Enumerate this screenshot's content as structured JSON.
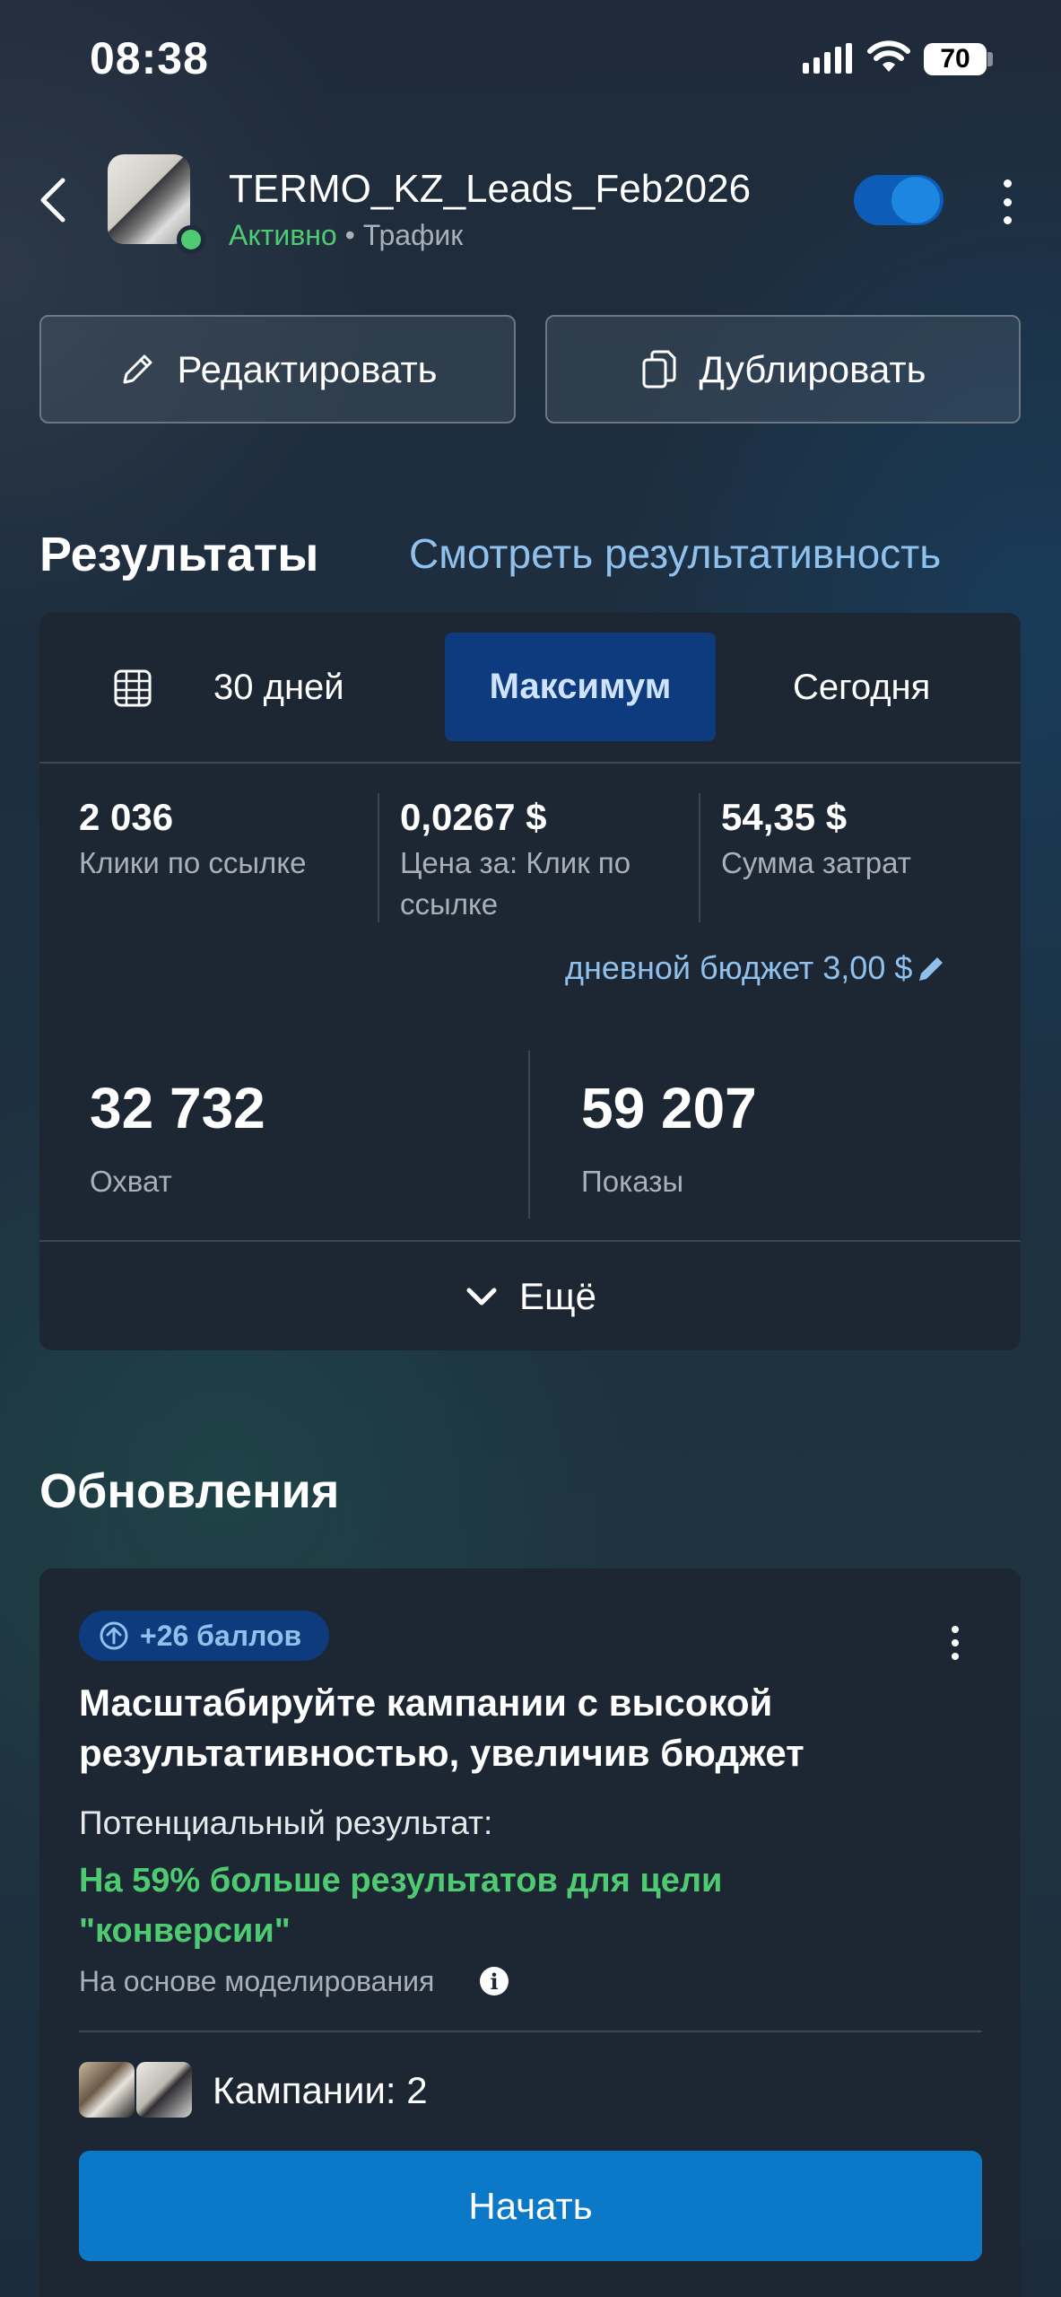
{
  "status_bar": {
    "time": "08:38",
    "battery": "70",
    "icons": [
      "signal-icon",
      "wifi-icon",
      "battery-icon"
    ]
  },
  "header": {
    "back_icon": "chevron-left-icon",
    "campaign_name": "TERMO_KZ_Leads_Feb2026",
    "status": "Активно",
    "separator": "•",
    "objective": "Трафик",
    "toggle_on": true,
    "more_icon": "kebab-icon"
  },
  "actions": {
    "edit_label": "Редактировать",
    "edit_icon": "pencil-icon",
    "duplicate_label": "Дублировать",
    "duplicate_icon": "copy-icon"
  },
  "results": {
    "title": "Результаты",
    "view_link": "Смотреть результативность",
    "tabs": [
      {
        "label": "30 дней",
        "icon": "calendar-icon",
        "active": false
      },
      {
        "label": "Максимум",
        "active": true
      },
      {
        "label": "Сегодня",
        "active": false
      }
    ],
    "metrics": [
      {
        "value": "2 036",
        "label": "Клики по ссылке"
      },
      {
        "value": "0,0267 $",
        "label": "Цена за: Клик по ссылке"
      },
      {
        "value": "54,35 $",
        "label": "Сумма затрат"
      }
    ],
    "daily_budget": "дневной бюджет 3,00 $",
    "big_metrics": [
      {
        "value": "32 732",
        "label": "Охват"
      },
      {
        "value": "59 207",
        "label": "Показы"
      }
    ],
    "more_label": "Ещё"
  },
  "updates": {
    "title": "Обновления",
    "card": {
      "badge": "+26 баллов",
      "headline": "Масштабируйте кампании с высокой результативностью, увеличив бюджет",
      "potential_label": "Потенциальный результат:",
      "potential_value": "На 59% больше результатов для цели \"конверсии\"",
      "basis": "На основе моделирования",
      "campaigns": "Кампании: 2",
      "cta": "Начать"
    }
  },
  "colors": {
    "accent": "#0b79c7",
    "active_tab": "#0d3b7d",
    "link": "#8fc1ec",
    "success": "#4ecb71",
    "card": "#1d2733"
  }
}
